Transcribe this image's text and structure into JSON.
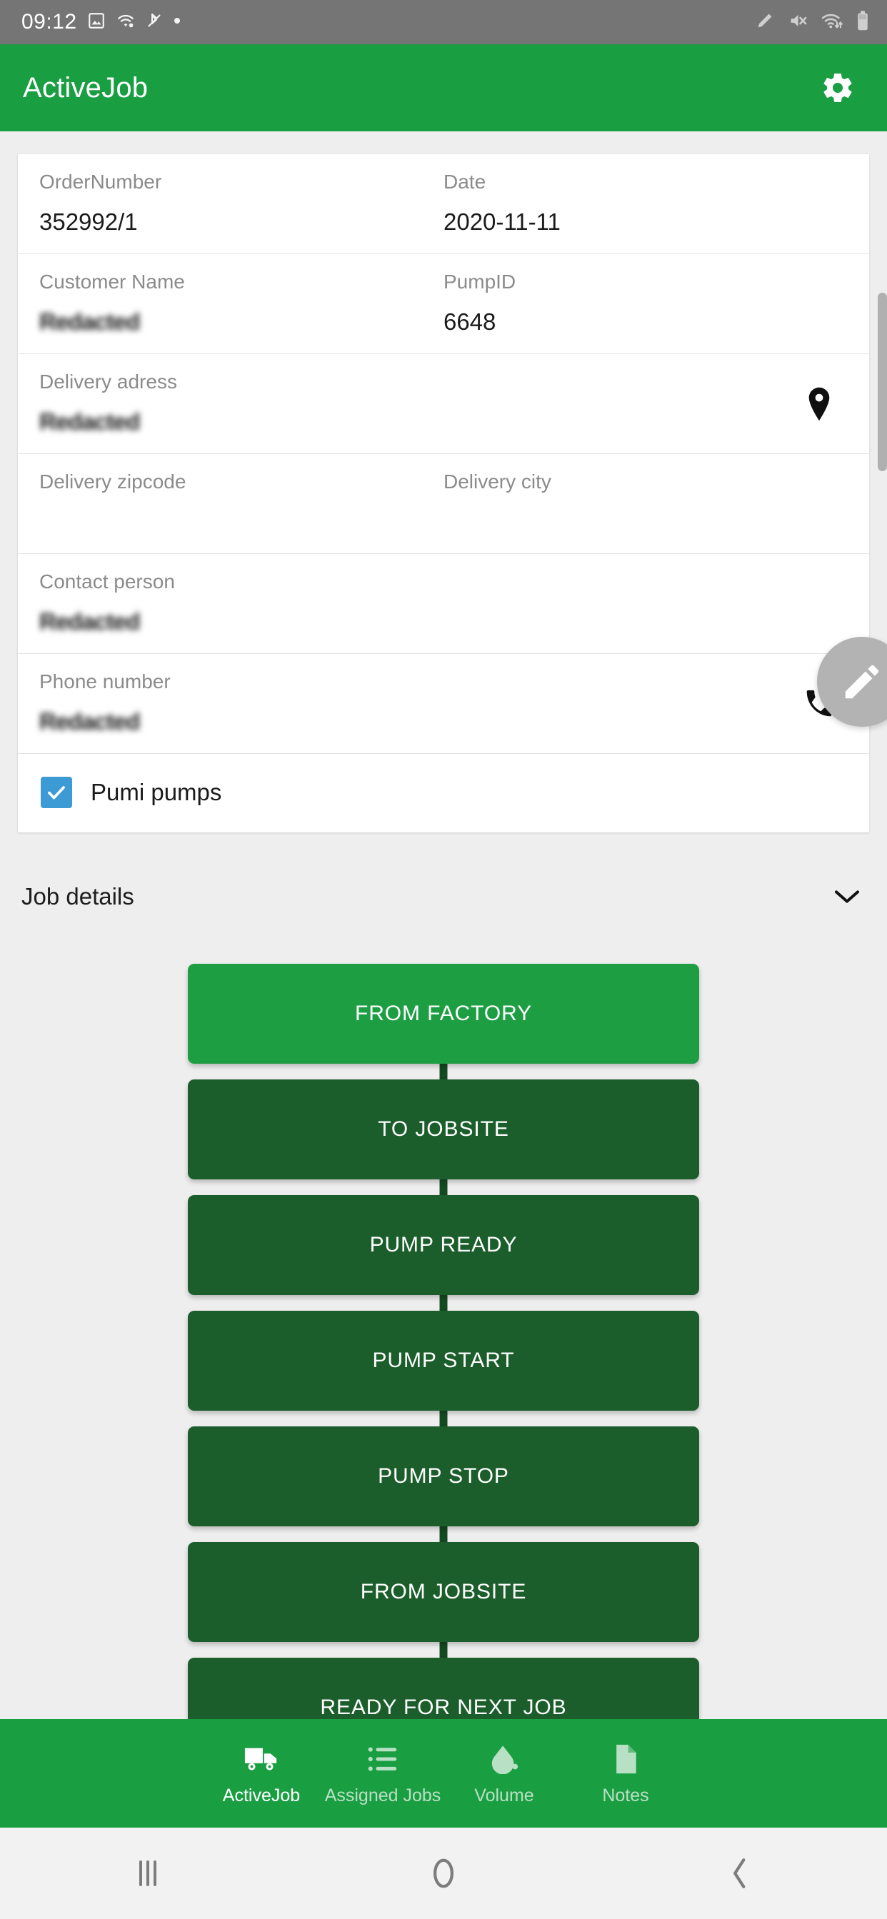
{
  "status_bar": {
    "clock": "09:12",
    "left_icons": [
      "image-icon",
      "wifi-calling-icon",
      "bluetooth-off-icon",
      "dot-icon"
    ],
    "right_icons": [
      "pen-icon",
      "mute-icon",
      "wifi-transfer-icon",
      "battery-icon"
    ]
  },
  "app_bar": {
    "title": "ActiveJob",
    "settings_icon": "gear-icon"
  },
  "job_card": {
    "rows": [
      {
        "left_label": "OrderNumber",
        "left_value": "352992/1",
        "right_label": "Date",
        "right_value": "2020-11-11"
      },
      {
        "left_label": "Customer Name",
        "left_value": "Redacted",
        "right_label": "PumpID",
        "right_value": "6648"
      },
      {
        "left_label": "Delivery adress",
        "left_value": "Redacted",
        "action_icon": "map-pin-icon"
      },
      {
        "left_label": "Delivery zipcode",
        "left_value": "",
        "right_label": "Delivery city",
        "right_value": ""
      },
      {
        "left_label": "Contact person",
        "left_value": "Redacted"
      },
      {
        "left_label": "Phone number",
        "left_value": "Redacted",
        "action_icon": "phone-icon"
      }
    ],
    "checkbox": {
      "label": "Pumi pumps",
      "checked": true,
      "color": "#3c9bd5"
    }
  },
  "job_details": {
    "title": "Job details",
    "expand_icon": "chevron-down-icon"
  },
  "workflow": {
    "steps": [
      {
        "label": "FROM FACTORY",
        "state": "active"
      },
      {
        "label": "TO JOBSITE",
        "state": "inactive"
      },
      {
        "label": "PUMP READY",
        "state": "inactive"
      },
      {
        "label": "PUMP START",
        "state": "inactive"
      },
      {
        "label": "PUMP STOP",
        "state": "inactive"
      },
      {
        "label": "FROM JOBSITE",
        "state": "inactive"
      },
      {
        "label": "READY FOR NEXT JOB",
        "state": "inactive"
      }
    ],
    "active_color": "#1e9e43",
    "inactive_color": "#1b5e2b",
    "connector_color": "#144a22"
  },
  "fab": {
    "icon": "pencil-edit-icon"
  },
  "bottom_nav": {
    "items": [
      {
        "label": "ActiveJob",
        "icon": "truck-icon",
        "active": true
      },
      {
        "label": "Assigned Jobs",
        "icon": "list-icon",
        "active": false
      },
      {
        "label": "Volume",
        "icon": "fill-drop-icon",
        "active": false
      },
      {
        "label": "Notes",
        "icon": "document-icon",
        "active": false
      }
    ],
    "background": "#1a9e42"
  },
  "android_nav": {
    "recents_label": "recents-icon",
    "home_label": "home-icon",
    "back_label": "back-icon"
  }
}
